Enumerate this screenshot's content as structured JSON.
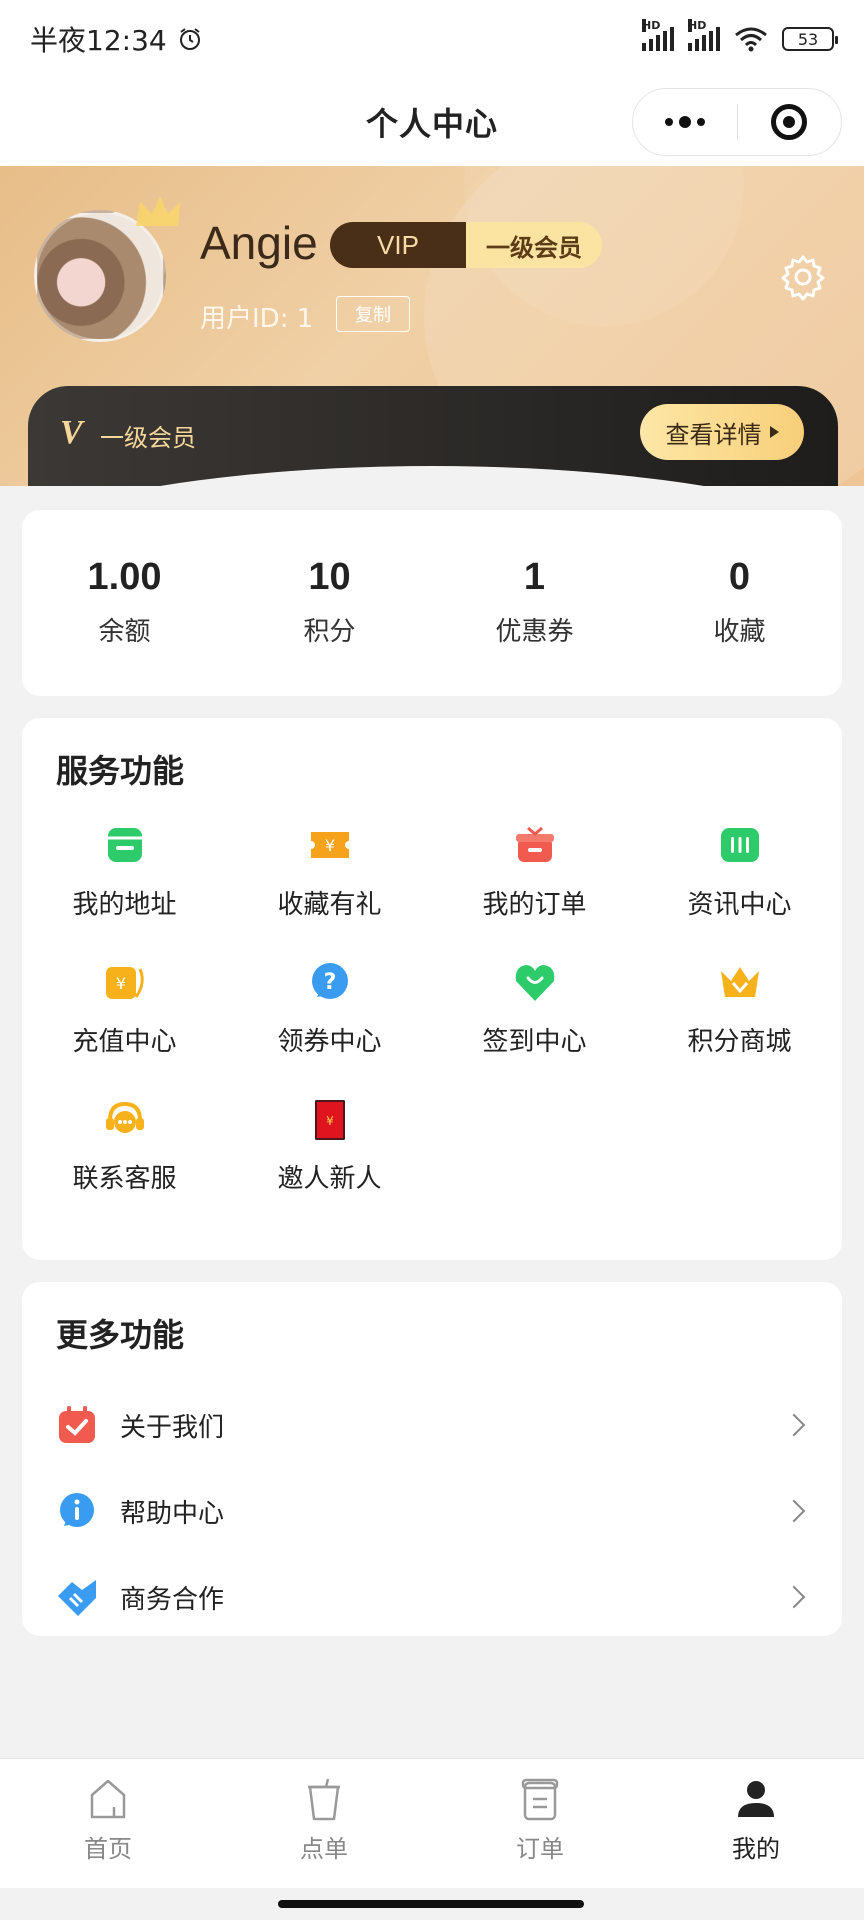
{
  "status_bar": {
    "time": "半夜12:34",
    "network_1": "HD",
    "network_2": "HD",
    "battery": "53"
  },
  "nav": {
    "title": "个人中心"
  },
  "profile": {
    "name": "Angie",
    "vip_label": "VIP",
    "level_label": "一级会员",
    "user_id": "用户ID: 1",
    "copy_label": "复制"
  },
  "member_card": {
    "icon_letter": "V",
    "label": "一级会员",
    "detail_button": "查看详情"
  },
  "stats": [
    {
      "value": "1.00",
      "label": "余额"
    },
    {
      "value": "10",
      "label": "积分"
    },
    {
      "value": "1",
      "label": "优惠券"
    },
    {
      "value": "0",
      "label": "收藏"
    }
  ],
  "services": {
    "title": "服务功能",
    "items": [
      {
        "label": "我的地址",
        "icon": "store-icon",
        "color": "#2ecb6a"
      },
      {
        "label": "收藏有礼",
        "icon": "yen-ticket-icon",
        "color": "#f7a21b"
      },
      {
        "label": "我的订单",
        "icon": "gift-icon",
        "color": "#f05a4f"
      },
      {
        "label": "资讯中心",
        "icon": "news-icon",
        "color": "#2ecb6a"
      },
      {
        "label": "充值中心",
        "icon": "yen-card-icon",
        "color": "#f7b21b"
      },
      {
        "label": "领券中心",
        "icon": "question-bubble-icon",
        "color": "#3a9cf0"
      },
      {
        "label": "签到中心",
        "icon": "heart-smile-icon",
        "color": "#2ecb6a"
      },
      {
        "label": "积分商城",
        "icon": "crown-icon",
        "color": "#f7b21b"
      },
      {
        "label": "联系客服",
        "icon": "headset-icon",
        "color": "#f7b21b"
      },
      {
        "label": "邀人新人",
        "icon": "red-envelope-icon",
        "color": "#e0141e"
      }
    ]
  },
  "more": {
    "title": "更多功能",
    "items": [
      {
        "label": "关于我们",
        "icon": "calendar-check-icon",
        "color": "#f05a4f"
      },
      {
        "label": "帮助中心",
        "icon": "info-bubble-icon",
        "color": "#3a9cf0"
      },
      {
        "label": "商务合作",
        "icon": "handshake-icon",
        "color": "#3a9cf0"
      }
    ]
  },
  "tabbar": [
    {
      "label": "首页",
      "icon": "home-icon",
      "active": false
    },
    {
      "label": "点单",
      "icon": "cup-icon",
      "active": false
    },
    {
      "label": "订单",
      "icon": "order-icon",
      "active": false
    },
    {
      "label": "我的",
      "icon": "user-icon",
      "active": true
    }
  ]
}
